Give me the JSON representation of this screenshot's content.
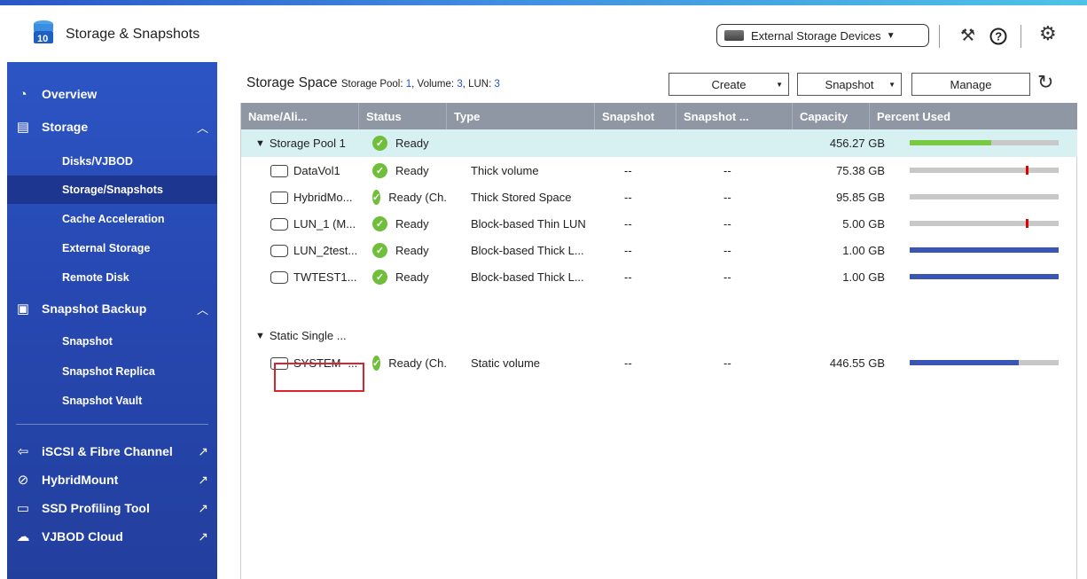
{
  "app": {
    "title": "Storage & Snapshots"
  },
  "header": {
    "external_devices_label": "External Storage Devices"
  },
  "sidebar": {
    "overview": "Overview",
    "storage": "Storage",
    "storage_items": [
      "Disks/VJBOD",
      "Storage/Snapshots",
      "Cache Acceleration",
      "External Storage",
      "Remote Disk"
    ],
    "snapshot_backup": "Snapshot Backup",
    "snapshot_items": [
      "Snapshot",
      "Snapshot Replica",
      "Snapshot Vault"
    ],
    "external_apps": [
      "iSCSI & Fibre Channel",
      "HybridMount",
      "SSD Profiling Tool",
      "VJBOD Cloud"
    ]
  },
  "main": {
    "title": "Storage Space",
    "pool_label": "Storage Pool:",
    "pool_count": "1",
    "volume_label": "Volume:",
    "volume_count": "3",
    "lun_label": "LUN:",
    "lun_count": "3",
    "buttons": {
      "create": "Create",
      "snapshot": "Snapshot",
      "manage": "Manage"
    }
  },
  "table": {
    "headers": [
      "Name/Ali...",
      "Status",
      "Type",
      "Snapshot",
      "Snapshot ...",
      "Capacity",
      "Percent Used"
    ],
    "pool_row": {
      "name": "Storage Pool 1",
      "status": "Ready",
      "capacity": "456.27 GB",
      "percent_used": 0.55,
      "bar_color": "#7ac943"
    },
    "pool_rows": [
      {
        "name": "DataVol1",
        "icon": "thick-volume-icon",
        "status": "Ready",
        "type": "Thick volume",
        "snapshot": "--",
        "snapshot2": "--",
        "capacity": "75.38 GB",
        "percent_used": 0.0,
        "mark": 0.78
      },
      {
        "name": "HybridMo...",
        "icon": "stored-space-icon",
        "status": "Ready (Ch...",
        "type": "Thick Stored Space",
        "snapshot": "--",
        "snapshot2": "--",
        "capacity": "95.85 GB",
        "percent_used": 0.0,
        "mark": null
      },
      {
        "name": "LUN_1 (M...",
        "icon": "lun-icon",
        "status": "Ready",
        "type": "Block-based Thin LUN",
        "snapshot": "--",
        "snapshot2": "--",
        "capacity": "5.00 GB",
        "percent_used": 0.0,
        "mark": 0.78
      },
      {
        "name": "LUN_2test...",
        "icon": "lun-icon",
        "status": "Ready",
        "type": "Block-based Thick L...",
        "snapshot": "--",
        "snapshot2": "--",
        "capacity": "1.00 GB",
        "percent_used": 1.0,
        "mark": null
      },
      {
        "name": "TWTEST1...",
        "icon": "lun-icon",
        "status": "Ready",
        "type": "Block-based Thick L...",
        "snapshot": "--",
        "snapshot2": "--",
        "capacity": "1.00 GB",
        "percent_used": 1.0,
        "mark": null
      }
    ],
    "static_group": {
      "name": "Static Single ..."
    },
    "static_rows": [
      {
        "name": "SYSTEM -...",
        "icon": "static-volume-icon",
        "status": "Ready (Ch...",
        "type": "Static volume",
        "snapshot": "--",
        "snapshot2": "--",
        "capacity": "446.55 GB",
        "percent_used": 0.73
      }
    ]
  },
  "colors": {
    "sidebar": "#2a51bd",
    "used_blue": "#3a55b4",
    "used_green": "#7ac943",
    "pool_row_bg": "#d7f1f3",
    "highlight": "#d9232d"
  }
}
